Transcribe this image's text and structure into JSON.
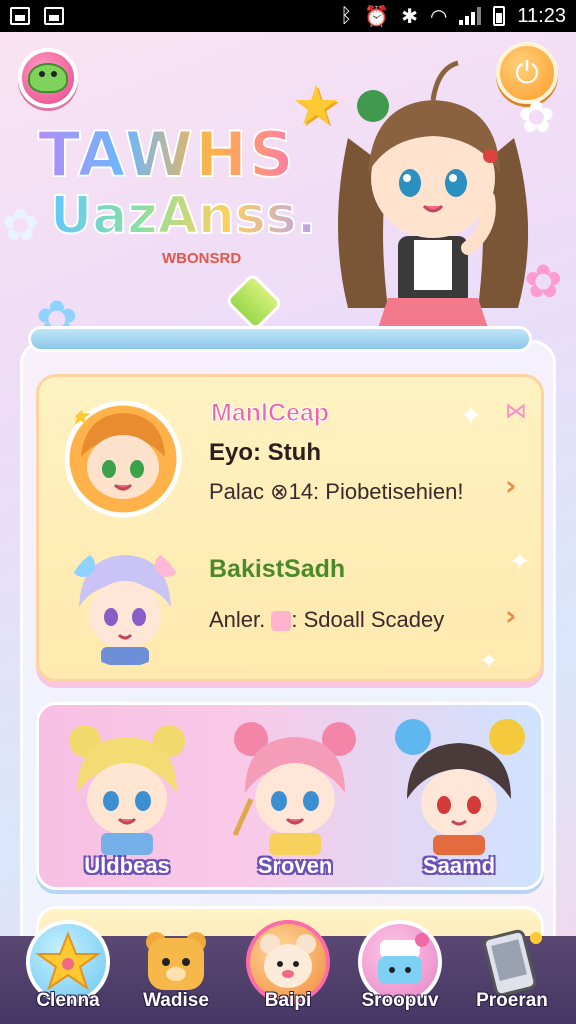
{
  "status_bar": {
    "time": "11:23"
  },
  "header": {
    "title_line1": "TAWHS",
    "title_line2": "UazAnss.",
    "subtitle": "WBONSRD"
  },
  "featured": {
    "rows": [
      {
        "title": "ManlCeap",
        "line1": "Eyo: Stuh",
        "line2": "Palac ⊗14: Piobetisehien!"
      },
      {
        "title": "BakistSadh",
        "line1": "Anler. ",
        "line1_tail": ": Sdoall Scadey"
      }
    ]
  },
  "characters": [
    {
      "name": "Uldbeas"
    },
    {
      "name": "Sroven"
    },
    {
      "name": "Saamd"
    }
  ],
  "bottom_nav": [
    {
      "label": "Clenna",
      "icon": "star-icon"
    },
    {
      "label": "Wadise",
      "icon": "bear-icon"
    },
    {
      "label": "Baipi",
      "icon": "bunny-icon"
    },
    {
      "label": "Sroopuv",
      "icon": "shop-icon"
    },
    {
      "label": "Proeran",
      "icon": "phone-icon"
    }
  ],
  "colors": {
    "accent_pink": "#f08ac0",
    "accent_yellow": "#ffe9ae",
    "nav_bg": "#4f3f6c",
    "chevron": "#f08a4b"
  }
}
